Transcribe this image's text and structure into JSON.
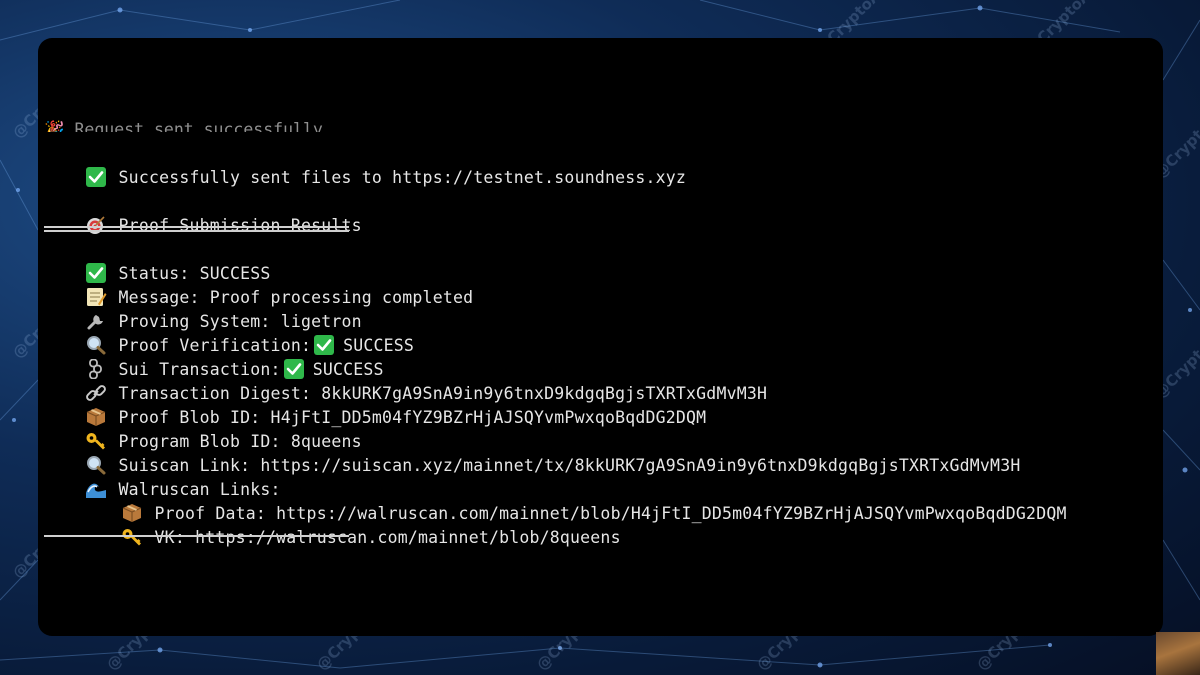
{
  "background": {
    "watermark_text": "@CryptoAlphaX",
    "colors": {
      "bg_dark": "#050f24",
      "bg_mid": "#1f4f8a",
      "node": "#7fb3ff"
    }
  },
  "terminal": {
    "colors": {
      "background": "#000000",
      "text": "#e6e6e6",
      "check_green": "#2fb84a"
    },
    "cutoff_line": "🎉 Request sent successfully",
    "sent_line": {
      "icon": "check-icon",
      "text": "Successfully sent files to https://testnet.soundness.xyz"
    },
    "results_header": {
      "icon": "target-icon",
      "text": "Proof Submission Results"
    },
    "status": {
      "icon": "check-icon",
      "text": "Status: SUCCESS"
    },
    "message": {
      "icon": "memo-icon",
      "text": "Message: Proof processing completed"
    },
    "proving_system": {
      "icon": "wrench-icon",
      "text": "Proving System: ligetron"
    },
    "proof_verification": {
      "icon": "magnifier-icon",
      "label": "Proof Verification:",
      "value": "SUCCESS"
    },
    "sui_transaction": {
      "icon": "chain-icon",
      "label": "Sui Transaction:",
      "value": "SUCCESS"
    },
    "transaction_digest": {
      "icon": "link-icon",
      "text": "Transaction Digest: 8kkURK7gA9SnA9in9y6tnxD9kdgqBgjsTXRTxGdMvM3H"
    },
    "proof_blob": {
      "icon": "package-icon",
      "text": "Proof Blob ID: H4jFtI_DD5m04fYZ9BZrHjAJSQYvmPwxqoBqdDG2DQM"
    },
    "program_blob": {
      "icon": "key-icon",
      "text": "Program Blob ID: 8queens"
    },
    "suiscan": {
      "icon": "magnifier-icon",
      "text": "Suiscan Link: https://suiscan.xyz/mainnet/tx/8kkURK7gA9SnA9in9y6tnxD9kdgqBgjsTXRTxGdMvM3H"
    },
    "walruscan": {
      "icon": "wave-icon",
      "text": "Walruscan Links:"
    },
    "proof_data": {
      "icon": "package-icon",
      "text": "Proof Data: https://walruscan.com/mainnet/blob/H4jFtI_DD5m04fYZ9BZrHjAJSQYvmPwxqoBqdDG2DQM"
    },
    "vk": {
      "icon": "key-icon",
      "text": "VK: https://walruscan.com/mainnet/blob/8queens"
    }
  }
}
